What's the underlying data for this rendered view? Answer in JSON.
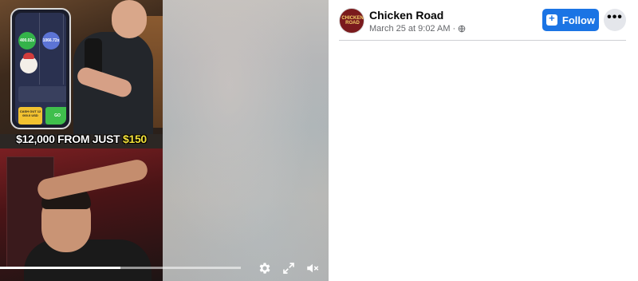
{
  "video": {
    "phone": {
      "multiplier_left": "400.02x",
      "multiplier_right": "1066.72x",
      "cashout_label": "CASH OUT 12 000.0 USD",
      "go_label": "GO"
    },
    "caption_prefix": "$12,000 FROM JUST ",
    "caption_highlight": "$150",
    "progress": 0.5,
    "controls": {
      "settings_icon": "gear-icon",
      "fullscreen_icon": "fullscreen-icon",
      "mute_icon": "volume-muted-icon"
    }
  },
  "post": {
    "page_name": "Chicken Road",
    "avatar_text": "CHICKEN ROAD",
    "timestamp": "March 25 at 9:02 AM",
    "separator": "·",
    "audience_icon": "globe-icon",
    "follow_label": "Follow",
    "more_label": "•••"
  },
  "colors": {
    "follow_blue": "#1b74e4",
    "caption_yellow": "#f3e13a",
    "avatar_red": "#7a1a1d"
  }
}
